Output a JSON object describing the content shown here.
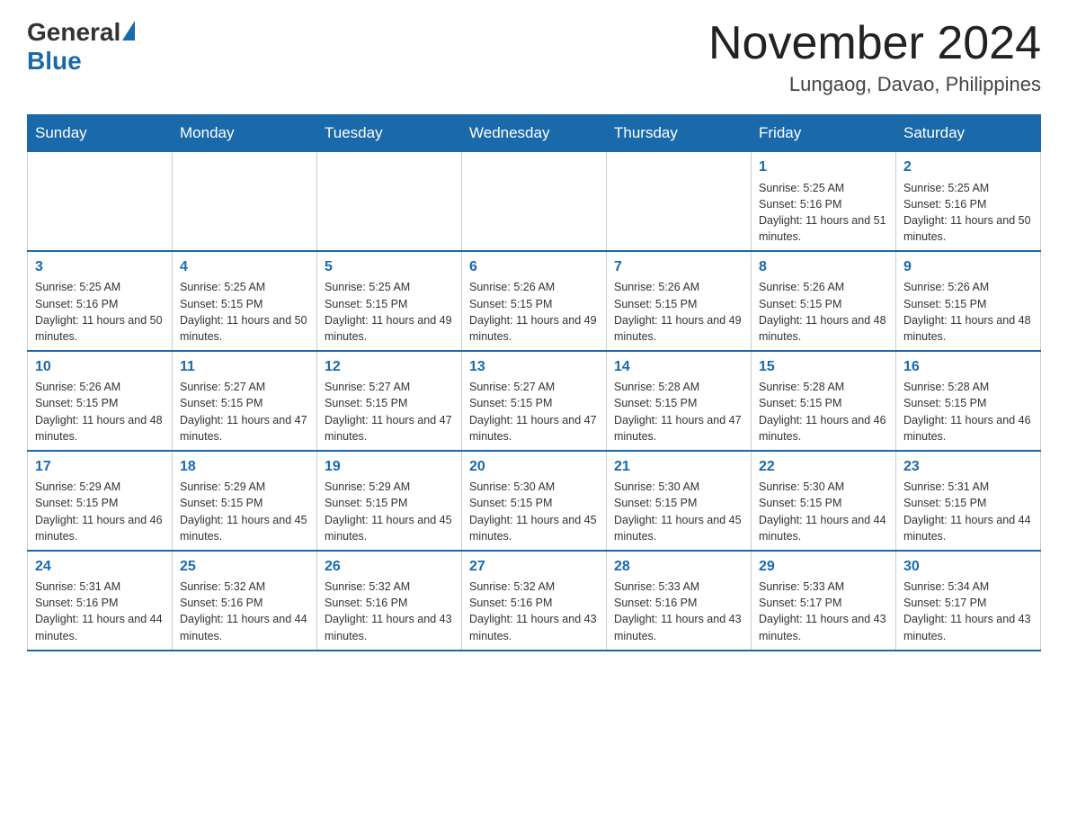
{
  "header": {
    "logo_general": "General",
    "logo_blue": "Blue",
    "month_title": "November 2024",
    "location": "Lungaog, Davao, Philippines"
  },
  "weekdays": [
    "Sunday",
    "Monday",
    "Tuesday",
    "Wednesday",
    "Thursday",
    "Friday",
    "Saturday"
  ],
  "weeks": [
    [
      {
        "day": "",
        "sunrise": "",
        "sunset": "",
        "daylight": ""
      },
      {
        "day": "",
        "sunrise": "",
        "sunset": "",
        "daylight": ""
      },
      {
        "day": "",
        "sunrise": "",
        "sunset": "",
        "daylight": ""
      },
      {
        "day": "",
        "sunrise": "",
        "sunset": "",
        "daylight": ""
      },
      {
        "day": "",
        "sunrise": "",
        "sunset": "",
        "daylight": ""
      },
      {
        "day": "1",
        "sunrise": "Sunrise: 5:25 AM",
        "sunset": "Sunset: 5:16 PM",
        "daylight": "Daylight: 11 hours and 51 minutes."
      },
      {
        "day": "2",
        "sunrise": "Sunrise: 5:25 AM",
        "sunset": "Sunset: 5:16 PM",
        "daylight": "Daylight: 11 hours and 50 minutes."
      }
    ],
    [
      {
        "day": "3",
        "sunrise": "Sunrise: 5:25 AM",
        "sunset": "Sunset: 5:16 PM",
        "daylight": "Daylight: 11 hours and 50 minutes."
      },
      {
        "day": "4",
        "sunrise": "Sunrise: 5:25 AM",
        "sunset": "Sunset: 5:15 PM",
        "daylight": "Daylight: 11 hours and 50 minutes."
      },
      {
        "day": "5",
        "sunrise": "Sunrise: 5:25 AM",
        "sunset": "Sunset: 5:15 PM",
        "daylight": "Daylight: 11 hours and 49 minutes."
      },
      {
        "day": "6",
        "sunrise": "Sunrise: 5:26 AM",
        "sunset": "Sunset: 5:15 PM",
        "daylight": "Daylight: 11 hours and 49 minutes."
      },
      {
        "day": "7",
        "sunrise": "Sunrise: 5:26 AM",
        "sunset": "Sunset: 5:15 PM",
        "daylight": "Daylight: 11 hours and 49 minutes."
      },
      {
        "day": "8",
        "sunrise": "Sunrise: 5:26 AM",
        "sunset": "Sunset: 5:15 PM",
        "daylight": "Daylight: 11 hours and 48 minutes."
      },
      {
        "day": "9",
        "sunrise": "Sunrise: 5:26 AM",
        "sunset": "Sunset: 5:15 PM",
        "daylight": "Daylight: 11 hours and 48 minutes."
      }
    ],
    [
      {
        "day": "10",
        "sunrise": "Sunrise: 5:26 AM",
        "sunset": "Sunset: 5:15 PM",
        "daylight": "Daylight: 11 hours and 48 minutes."
      },
      {
        "day": "11",
        "sunrise": "Sunrise: 5:27 AM",
        "sunset": "Sunset: 5:15 PM",
        "daylight": "Daylight: 11 hours and 47 minutes."
      },
      {
        "day": "12",
        "sunrise": "Sunrise: 5:27 AM",
        "sunset": "Sunset: 5:15 PM",
        "daylight": "Daylight: 11 hours and 47 minutes."
      },
      {
        "day": "13",
        "sunrise": "Sunrise: 5:27 AM",
        "sunset": "Sunset: 5:15 PM",
        "daylight": "Daylight: 11 hours and 47 minutes."
      },
      {
        "day": "14",
        "sunrise": "Sunrise: 5:28 AM",
        "sunset": "Sunset: 5:15 PM",
        "daylight": "Daylight: 11 hours and 47 minutes."
      },
      {
        "day": "15",
        "sunrise": "Sunrise: 5:28 AM",
        "sunset": "Sunset: 5:15 PM",
        "daylight": "Daylight: 11 hours and 46 minutes."
      },
      {
        "day": "16",
        "sunrise": "Sunrise: 5:28 AM",
        "sunset": "Sunset: 5:15 PM",
        "daylight": "Daylight: 11 hours and 46 minutes."
      }
    ],
    [
      {
        "day": "17",
        "sunrise": "Sunrise: 5:29 AM",
        "sunset": "Sunset: 5:15 PM",
        "daylight": "Daylight: 11 hours and 46 minutes."
      },
      {
        "day": "18",
        "sunrise": "Sunrise: 5:29 AM",
        "sunset": "Sunset: 5:15 PM",
        "daylight": "Daylight: 11 hours and 45 minutes."
      },
      {
        "day": "19",
        "sunrise": "Sunrise: 5:29 AM",
        "sunset": "Sunset: 5:15 PM",
        "daylight": "Daylight: 11 hours and 45 minutes."
      },
      {
        "day": "20",
        "sunrise": "Sunrise: 5:30 AM",
        "sunset": "Sunset: 5:15 PM",
        "daylight": "Daylight: 11 hours and 45 minutes."
      },
      {
        "day": "21",
        "sunrise": "Sunrise: 5:30 AM",
        "sunset": "Sunset: 5:15 PM",
        "daylight": "Daylight: 11 hours and 45 minutes."
      },
      {
        "day": "22",
        "sunrise": "Sunrise: 5:30 AM",
        "sunset": "Sunset: 5:15 PM",
        "daylight": "Daylight: 11 hours and 44 minutes."
      },
      {
        "day": "23",
        "sunrise": "Sunrise: 5:31 AM",
        "sunset": "Sunset: 5:15 PM",
        "daylight": "Daylight: 11 hours and 44 minutes."
      }
    ],
    [
      {
        "day": "24",
        "sunrise": "Sunrise: 5:31 AM",
        "sunset": "Sunset: 5:16 PM",
        "daylight": "Daylight: 11 hours and 44 minutes."
      },
      {
        "day": "25",
        "sunrise": "Sunrise: 5:32 AM",
        "sunset": "Sunset: 5:16 PM",
        "daylight": "Daylight: 11 hours and 44 minutes."
      },
      {
        "day": "26",
        "sunrise": "Sunrise: 5:32 AM",
        "sunset": "Sunset: 5:16 PM",
        "daylight": "Daylight: 11 hours and 43 minutes."
      },
      {
        "day": "27",
        "sunrise": "Sunrise: 5:32 AM",
        "sunset": "Sunset: 5:16 PM",
        "daylight": "Daylight: 11 hours and 43 minutes."
      },
      {
        "day": "28",
        "sunrise": "Sunrise: 5:33 AM",
        "sunset": "Sunset: 5:16 PM",
        "daylight": "Daylight: 11 hours and 43 minutes."
      },
      {
        "day": "29",
        "sunrise": "Sunrise: 5:33 AM",
        "sunset": "Sunset: 5:17 PM",
        "daylight": "Daylight: 11 hours and 43 minutes."
      },
      {
        "day": "30",
        "sunrise": "Sunrise: 5:34 AM",
        "sunset": "Sunset: 5:17 PM",
        "daylight": "Daylight: 11 hours and 43 minutes."
      }
    ]
  ]
}
